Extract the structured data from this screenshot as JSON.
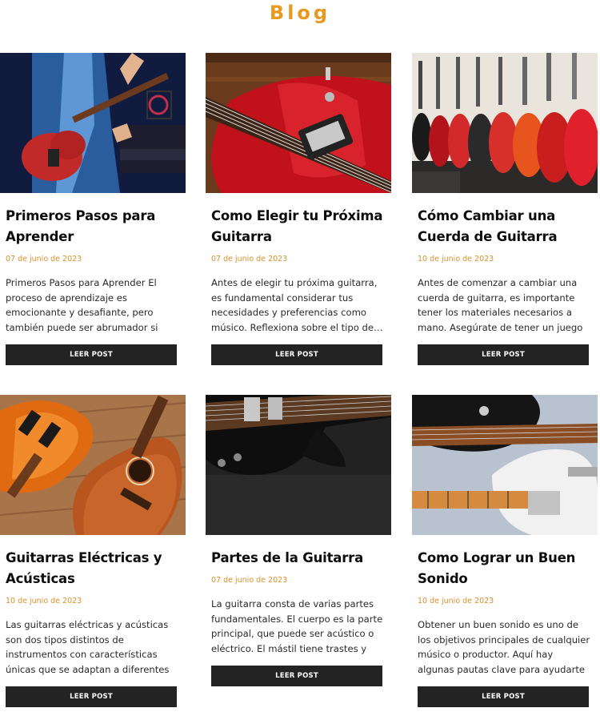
{
  "page": {
    "title": "Blog"
  },
  "button_label": "LEER POST",
  "colors": {
    "accent": "#e8991f",
    "date": "#d9902c",
    "button_bg": "#232323"
  },
  "posts": [
    {
      "title_line1": "Primeros Pasos para",
      "title_line2": "Aprender",
      "date": "07 de junio de 2023",
      "excerpt": "Primeros Pasos para Aprender El proceso de aprendizaje es emocionante y desafiante, pero también puede ser abrumador si no…",
      "image": "person-playing-red-electric-guitar"
    },
    {
      "title_line1": "Como Elegir tu Próxima",
      "title_line2": "Guitarra",
      "date": "07 de junio de 2023",
      "excerpt": "Antes de elegir tu próxima guitarra, es fundamental considerar tus necesidades y preferencias como músico. Reflexiona sobre el tipo de…",
      "image": "red-electric-guitar-closeup"
    },
    {
      "title_line1": "Cómo Cambiar una",
      "title_line2": "Cuerda de Guitarra",
      "date": "10 de junio de 2023",
      "excerpt": "Antes de comenzar a cambiar una cuerda de guitarra, es importante tener los materiales necesarios a mano. Asegúrate de tener un juego d…",
      "image": "row-of-guitars-in-store"
    },
    {
      "title_line1": "Guitarras Eléctricas y",
      "title_line2": "Acústicas",
      "date": "10 de junio de 2023",
      "excerpt": "Las guitarras eléctricas y acústicas son dos tipos distintos de instrumentos con características únicas que se adaptan a diferentes estilos musicales y…",
      "image": "electric-and-acoustic-guitars-on-wood"
    },
    {
      "title_line1": "Partes de la Guitarra",
      "title_line2": "",
      "date": "07 de junio de 2023",
      "excerpt": "La guitarra consta de varias partes fundamentales. El cuerpo es la parte principal, que puede ser acústico o eléctrico. El mástil tiene trastes y se…",
      "image": "black-electric-guitar"
    },
    {
      "title_line1": "Como Lograr un Buen",
      "title_line2": "Sonido",
      "date": "10 de junio de 2023",
      "excerpt": "Obtener un buen sonido es uno de los objetivos principales de cualquier músico o productor. Aquí hay algunas pautas clave para ayudarte a lograr…",
      "image": "white-and-black-electric-guitars"
    }
  ]
}
